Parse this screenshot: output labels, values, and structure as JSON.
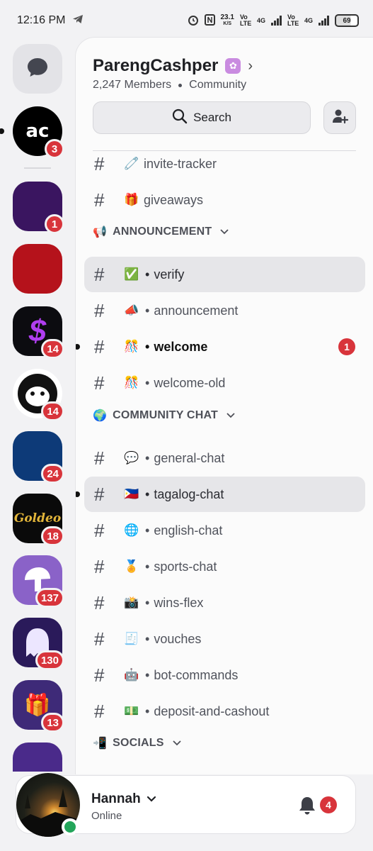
{
  "status_bar": {
    "time": "12:16 PM",
    "net_speed": "23.1",
    "net_unit": "K/S",
    "sim1_label": "Vo LTE",
    "sim1_type": "4G",
    "sim2_label": "Vo LTE",
    "sim2_type": "4G",
    "battery": "69",
    "icons": [
      "telegram-icon",
      "alarm-icon",
      "nfc-icon"
    ]
  },
  "rail": {
    "dm_icon": "chat-bubble-icon",
    "servers": [
      {
        "name": "AC server",
        "badge": "3",
        "bg": "#000000",
        "unread": true
      },
      {
        "name": "Stake server",
        "badge": "1",
        "bg": "#3a1560",
        "unread": false
      },
      {
        "name": "Reaper server",
        "badge": "",
        "bg": "#b5121b",
        "unread": false
      },
      {
        "name": "Dollar server",
        "badge": "14",
        "bg": "#0c0c10",
        "unread": false
      },
      {
        "name": "Monkey server",
        "badge": "14",
        "bg": "#ffffff",
        "unread": false
      },
      {
        "name": "Kayz Gamble",
        "badge": "24",
        "bg": "#0d3a78",
        "unread": false
      },
      {
        "name": "Goldeo",
        "badge": "18",
        "bg": "#0a0a0a",
        "unread": false
      },
      {
        "name": "Mushroom server",
        "badge": "137",
        "bg": "#8a62c8",
        "unread": false
      },
      {
        "name": "Ghost server",
        "badge": "130",
        "bg": "#2a1a5a",
        "unread": false
      },
      {
        "name": "Gift server",
        "badge": "13",
        "bg": "#3e2a78",
        "unread": false
      },
      {
        "name": "Hex server",
        "badge": "",
        "bg": "#4a2a8a",
        "unread": false
      }
    ]
  },
  "server": {
    "name": "ParengCashper",
    "members": "2,247 Members",
    "type": "Community",
    "search_label": "Search"
  },
  "channels": [
    {
      "kind": "channel",
      "emoji": "🧷",
      "sep": "",
      "name": "invite-tracker"
    },
    {
      "kind": "channel",
      "emoji": "🎁",
      "sep": "",
      "name": "giveaways"
    },
    {
      "kind": "category",
      "emoji": "📢",
      "name": "ANNOUNCEMENT"
    },
    {
      "kind": "channel",
      "emoji": "✅",
      "sep": "•",
      "name": "verify",
      "active": true
    },
    {
      "kind": "channel",
      "emoji": "📣",
      "sep": "•",
      "name": "announcement"
    },
    {
      "kind": "channel",
      "emoji": "🎊",
      "sep": "•",
      "name": "welcome",
      "unread": true,
      "count": "1"
    },
    {
      "kind": "channel",
      "emoji": "🎊",
      "sep": "•",
      "name": "welcome-old"
    },
    {
      "kind": "category",
      "emoji": "🌍",
      "name": "COMMUNITY CHAT"
    },
    {
      "kind": "channel",
      "emoji": "💬",
      "sep": "•",
      "name": "general-chat"
    },
    {
      "kind": "channel",
      "emoji": "🇵🇭",
      "sep": "•",
      "name": "tagalog-chat",
      "active": true,
      "pip": true
    },
    {
      "kind": "channel",
      "emoji": "🌐",
      "sep": "•",
      "name": "english-chat"
    },
    {
      "kind": "channel",
      "emoji": "🏅",
      "sep": "•",
      "name": "sports-chat"
    },
    {
      "kind": "channel",
      "emoji": "📸",
      "sep": "•",
      "name": "wins-flex"
    },
    {
      "kind": "channel",
      "emoji": "🧾",
      "sep": "•",
      "name": "vouches"
    },
    {
      "kind": "channel",
      "emoji": "🤖",
      "sep": "•",
      "name": "bot-commands"
    },
    {
      "kind": "channel",
      "emoji": "💵",
      "sep": "•",
      "name": "deposit-and-cashout"
    },
    {
      "kind": "category",
      "emoji": "📲",
      "name": "SOCIALS"
    }
  ],
  "user": {
    "name": "Hannah",
    "status": "Online",
    "notifications": "4"
  },
  "colors": {
    "accent_red": "#d8343b",
    "online_green": "#23a55a",
    "boost_pink": "#c98be0"
  }
}
